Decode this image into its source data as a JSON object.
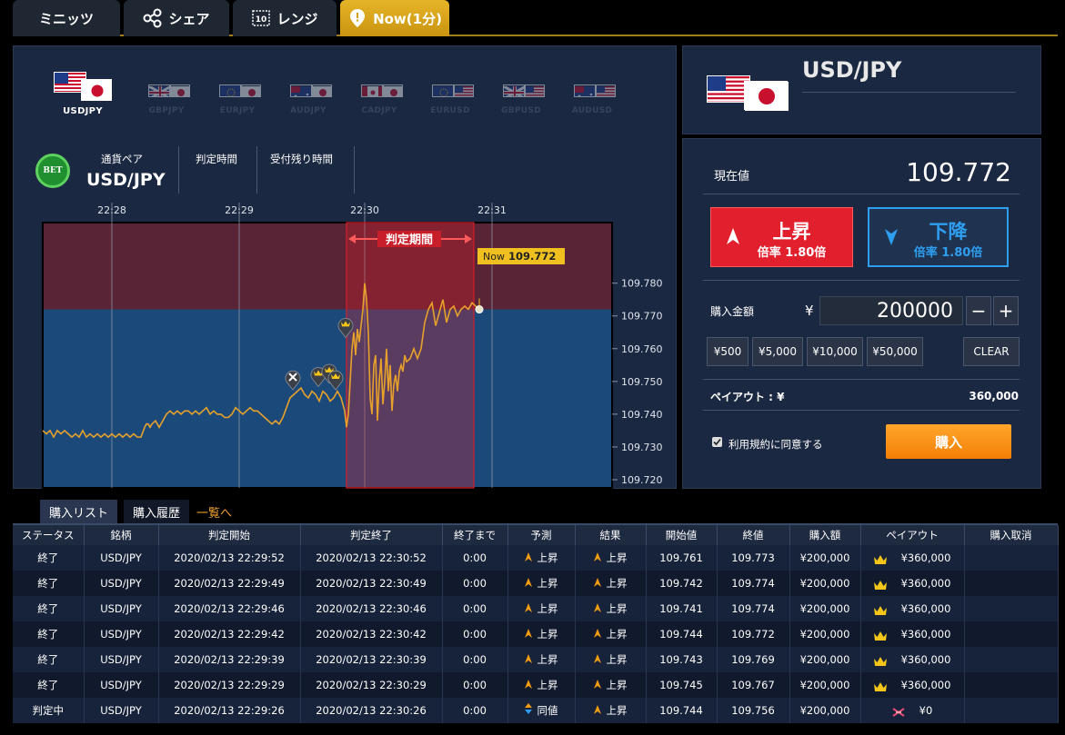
{
  "tabs": [
    {
      "label": "ミニッツ",
      "icon": "clock-icon"
    },
    {
      "label": "シェア",
      "icon": "share-icon"
    },
    {
      "label": "レンジ",
      "icon": "range-icon"
    },
    {
      "label": "Now(1分)",
      "icon": "now-pin-icon",
      "active": true
    }
  ],
  "pairs": [
    {
      "label": "USDJPY",
      "active": true
    },
    {
      "label": "GBPJPY"
    },
    {
      "label": "EURJPY"
    },
    {
      "label": "AUDJPY"
    },
    {
      "label": "CADJPY"
    },
    {
      "label": "EURUSD"
    },
    {
      "label": "GBPUSD"
    },
    {
      "label": "AUDUSD"
    }
  ],
  "info": {
    "bet_badge": "BET",
    "pair_label": "通貨ペア",
    "pair_value": "USD/JPY",
    "judge_time_label": "判定時間",
    "remaining_label": "受付残り時間"
  },
  "chart_data": {
    "type": "line",
    "time_ticks": [
      "22:28",
      "22:29",
      "22:30",
      "22:31"
    ],
    "y_ticks": [
      "109.780",
      "109.770",
      "109.760",
      "109.750",
      "109.740",
      "109.730",
      "109.720"
    ],
    "ylim": [
      109.7175,
      109.7985
    ],
    "strike": 109.772,
    "judge_period_label": "判定期間",
    "now_label": "Now",
    "now_value": "109.772",
    "colors": {
      "line": "#e7a12b",
      "upper": "#5a2437",
      "lower": "#1b4a7a",
      "judge": "rgba(220,30,40,0.32)"
    },
    "series": [
      {
        "values": [
          [
            0,
            109.735
          ],
          [
            4,
            109.734
          ],
          [
            8,
            109.735
          ],
          [
            12,
            109.733
          ],
          [
            16,
            109.735
          ],
          [
            20,
            109.734
          ],
          [
            24,
            109.735
          ],
          [
            28,
            109.734
          ],
          [
            32,
            109.733
          ],
          [
            36,
            109.734
          ],
          [
            40,
            109.733
          ],
          [
            44,
            109.735
          ],
          [
            48,
            109.733
          ],
          [
            52,
            109.734
          ],
          [
            56,
            109.733
          ],
          [
            60,
            109.734
          ],
          [
            64,
            109.733
          ],
          [
            68,
            109.734
          ],
          [
            72,
            109.733
          ],
          [
            76,
            109.734
          ],
          [
            80,
            109.733
          ],
          [
            84,
            109.734
          ],
          [
            88,
            109.733
          ],
          [
            92,
            109.734
          ],
          [
            96,
            109.733
          ],
          [
            100,
            109.734
          ],
          [
            104,
            109.733
          ],
          [
            108,
            109.733
          ],
          [
            112,
            109.736
          ],
          [
            114,
            109.737
          ],
          [
            116,
            109.737
          ],
          [
            118,
            109.736
          ],
          [
            120,
            109.737
          ],
          [
            124,
            109.738
          ],
          [
            128,
            109.736
          ],
          [
            132,
            109.738
          ],
          [
            136,
            109.74
          ],
          [
            140,
            109.741
          ],
          [
            144,
            109.74
          ],
          [
            148,
            109.741
          ],
          [
            152,
            109.74
          ],
          [
            156,
            109.741
          ],
          [
            160,
            109.741
          ],
          [
            164,
            109.74
          ],
          [
            168,
            109.741
          ],
          [
            172,
            109.74
          ],
          [
            176,
            109.741
          ],
          [
            180,
            109.742
          ],
          [
            184,
            109.74
          ],
          [
            188,
            109.741
          ],
          [
            192,
            109.74
          ],
          [
            196,
            109.74
          ],
          [
            200,
            109.739
          ],
          [
            204,
            109.739
          ],
          [
            208,
            109.74
          ],
          [
            212,
            109.742
          ],
          [
            216,
            109.741
          ],
          [
            220,
            109.74
          ],
          [
            224,
            109.741
          ],
          [
            228,
            109.742
          ],
          [
            232,
            109.741
          ],
          [
            236,
            109.741
          ],
          [
            240,
            109.74
          ],
          [
            244,
            109.739
          ],
          [
            248,
            109.738
          ],
          [
            252,
            109.737
          ],
          [
            256,
            109.738
          ],
          [
            260,
            109.737
          ],
          [
            264,
            109.739
          ],
          [
            268,
            109.742
          ],
          [
            272,
            109.745
          ],
          [
            276,
            109.746
          ],
          [
            280,
            109.747
          ],
          [
            284,
            109.748
          ],
          [
            288,
            109.746
          ],
          [
            292,
            109.745
          ],
          [
            296,
            109.747
          ],
          [
            300,
            109.746
          ],
          [
            304,
            109.744
          ],
          [
            308,
            109.747
          ],
          [
            312,
            109.746
          ],
          [
            316,
            109.744
          ],
          [
            320,
            109.745
          ],
          [
            324,
            109.747
          ],
          [
            328,
            109.745
          ],
          [
            332,
            109.741
          ],
          [
            334,
            109.736
          ],
          [
            336,
            109.74
          ],
          [
            338,
            109.75
          ],
          [
            340,
            109.76
          ],
          [
            342,
            109.765
          ],
          [
            344,
            109.758
          ],
          [
            346,
            109.766
          ],
          [
            348,
            109.762
          ],
          [
            350,
            109.767
          ],
          [
            352,
            109.772
          ],
          [
            354,
            109.78
          ],
          [
            356,
            109.775
          ],
          [
            358,
            109.765
          ],
          [
            360,
            109.745
          ],
          [
            362,
            109.74
          ],
          [
            364,
            109.755
          ],
          [
            366,
            109.758
          ],
          [
            368,
            109.738
          ],
          [
            370,
            109.75
          ],
          [
            372,
            109.757
          ],
          [
            374,
            109.743
          ],
          [
            376,
            109.75
          ],
          [
            378,
            109.76
          ],
          [
            380,
            109.747
          ],
          [
            382,
            109.755
          ],
          [
            384,
            109.741
          ],
          [
            386,
            109.749
          ],
          [
            388,
            109.752
          ],
          [
            390,
            109.747
          ],
          [
            392,
            109.753
          ],
          [
            394,
            109.755
          ],
          [
            396,
            109.753
          ],
          [
            398,
            109.758
          ],
          [
            400,
            109.756
          ],
          [
            404,
            109.757
          ],
          [
            408,
            109.76
          ],
          [
            412,
            109.757
          ],
          [
            416,
            109.76
          ],
          [
            420,
            109.768
          ],
          [
            424,
            109.772
          ],
          [
            428,
            109.774
          ],
          [
            432,
            109.767
          ],
          [
            436,
            109.771
          ],
          [
            440,
            109.775
          ],
          [
            444,
            109.768
          ],
          [
            448,
            109.772
          ],
          [
            452,
            109.773
          ],
          [
            456,
            109.77
          ],
          [
            460,
            109.772
          ],
          [
            464,
            109.773
          ],
          [
            468,
            109.772
          ],
          [
            472,
            109.774
          ],
          [
            476,
            109.773
          ],
          [
            480,
            109.772
          ]
        ]
      }
    ]
  },
  "header": {
    "pair_title": "USD/JPY"
  },
  "order": {
    "current_label": "現在値",
    "current_value": "109.772",
    "up_label": "上昇",
    "up_rate": "倍率 1.80倍",
    "down_label": "下降",
    "down_rate": "倍率 1.80倍",
    "amount_label": "購入金額",
    "yen_sign": "¥",
    "amount_value": "200000",
    "minus": "−",
    "plus": "+",
    "chips": [
      "¥500",
      "¥5,000",
      "¥10,000",
      "¥50,000"
    ],
    "clear": "CLEAR",
    "payout_label": "ペイアウト : ¥",
    "payout_value": "360,000",
    "terms_label": "利用規約に同意する",
    "buy_label": "購入"
  },
  "bottom_tabs": {
    "list": "購入リスト",
    "history": "購入履歴",
    "all_link": "一覧へ"
  },
  "table": {
    "headers": [
      "ステータス",
      "銘柄",
      "判定開始",
      "判定終了",
      "終了まで",
      "予測",
      "結果",
      "開始値",
      "終値",
      "購入額",
      "ペイアウト",
      "購入取消"
    ],
    "rows": [
      {
        "status": "終了",
        "symbol": "USD/JPY",
        "start": "2020/02/13 22:29:52",
        "end": "2020/02/13 22:30:52",
        "left": "0:00",
        "pred": "上昇",
        "pred_icon": "up",
        "result": "上昇",
        "open": "109.761",
        "close": "109.773",
        "amount": "¥200,000",
        "payout": "¥360,000",
        "win": true
      },
      {
        "status": "終了",
        "symbol": "USD/JPY",
        "start": "2020/02/13 22:29:49",
        "end": "2020/02/13 22:30:49",
        "left": "0:00",
        "pred": "上昇",
        "pred_icon": "up",
        "result": "上昇",
        "open": "109.742",
        "close": "109.774",
        "amount": "¥200,000",
        "payout": "¥360,000",
        "win": true
      },
      {
        "status": "終了",
        "symbol": "USD/JPY",
        "start": "2020/02/13 22:29:46",
        "end": "2020/02/13 22:30:46",
        "left": "0:00",
        "pred": "上昇",
        "pred_icon": "up",
        "result": "上昇",
        "open": "109.741",
        "close": "109.774",
        "amount": "¥200,000",
        "payout": "¥360,000",
        "win": true
      },
      {
        "status": "終了",
        "symbol": "USD/JPY",
        "start": "2020/02/13 22:29:42",
        "end": "2020/02/13 22:30:42",
        "left": "0:00",
        "pred": "上昇",
        "pred_icon": "up",
        "result": "上昇",
        "open": "109.744",
        "close": "109.772",
        "amount": "¥200,000",
        "payout": "¥360,000",
        "win": true
      },
      {
        "status": "終了",
        "symbol": "USD/JPY",
        "start": "2020/02/13 22:29:39",
        "end": "2020/02/13 22:30:39",
        "left": "0:00",
        "pred": "上昇",
        "pred_icon": "up",
        "result": "上昇",
        "open": "109.743",
        "close": "109.769",
        "amount": "¥200,000",
        "payout": "¥360,000",
        "win": true
      },
      {
        "status": "終了",
        "symbol": "USD/JPY",
        "start": "2020/02/13 22:29:29",
        "end": "2020/02/13 22:30:29",
        "left": "0:00",
        "pred": "上昇",
        "pred_icon": "up",
        "result": "上昇",
        "open": "109.745",
        "close": "109.767",
        "amount": "¥200,000",
        "payout": "¥360,000",
        "win": true
      },
      {
        "status": "判定中",
        "symbol": "USD/JPY",
        "start": "2020/02/13 22:29:26",
        "end": "2020/02/13 22:30:26",
        "left": "0:00",
        "pred": "同値",
        "pred_icon": "same",
        "result": "上昇",
        "open": "109.744",
        "close": "109.756",
        "amount": "¥200,000",
        "payout": "¥0",
        "win": false
      }
    ]
  }
}
